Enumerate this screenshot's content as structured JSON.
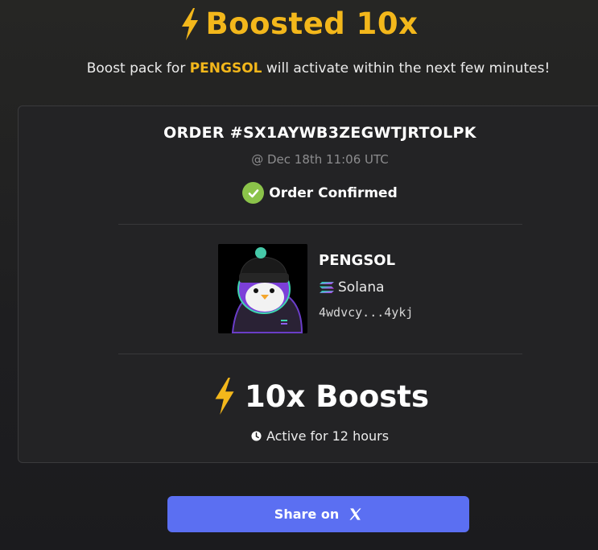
{
  "header": {
    "title": "Boosted 10x",
    "bolt_icon": "lightning-bolt-icon",
    "accent_color": "#f3b71b"
  },
  "subtitle": {
    "prefix": "Boost pack for ",
    "token": "PENGSOL",
    "suffix": " will activate within the next few minutes!"
  },
  "order": {
    "id": "ORDER #SX1AYWB3ZEGWTJRTOLPK",
    "time": "@ Dec 18th 11:06 UTC",
    "status": "Order Confirmed",
    "status_color": "#8bc34a"
  },
  "token": {
    "name": "PENGSOL",
    "chain": "Solana",
    "address": "4wdvcy...4ykj"
  },
  "boost": {
    "label": "10x Boosts",
    "duration": "Active for 12 hours"
  },
  "share": {
    "label": "Share on",
    "icon": "x-logo-icon",
    "color": "#5b6ff2"
  }
}
